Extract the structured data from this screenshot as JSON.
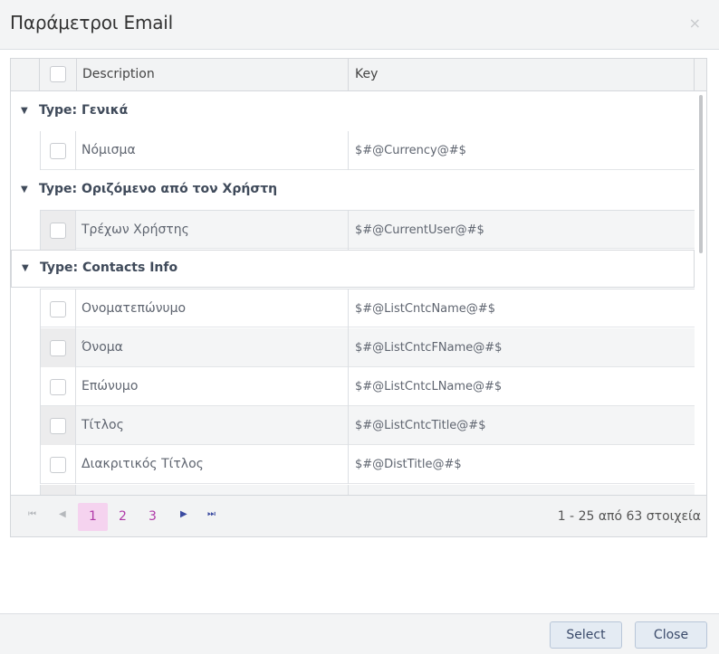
{
  "dialog": {
    "title": "Παράμετροι Email",
    "close_glyph": "×"
  },
  "grid": {
    "columns": {
      "description": "Description",
      "key": "Key"
    },
    "groups": [
      {
        "label": "Type: Γενικά",
        "rows": [
          {
            "description": "Νόμισμα",
            "key": "$#@Currency@#$"
          }
        ]
      },
      {
        "label": "Type: Οριζόμενο από τον Χρήστη",
        "rows": [
          {
            "description": "Τρέχων Χρήστης",
            "key": "$#@CurrentUser@#$"
          }
        ]
      },
      {
        "label": "Type: Contacts Info",
        "rows": [
          {
            "description": "Ονοματεπώνυμο",
            "key": "$#@ListCntcName@#$"
          },
          {
            "description": "Όνομα",
            "key": "$#@ListCntcFName@#$"
          },
          {
            "description": "Επώνυμο",
            "key": "$#@ListCntcLName@#$"
          },
          {
            "description": "Τίτλος",
            "key": "$#@ListCntcTitle@#$"
          },
          {
            "description": "Διακριτικός Τίτλος",
            "key": "$#@DistTitle@#$"
          }
        ]
      }
    ]
  },
  "pager": {
    "first_icon": "first-page-icon",
    "prev_icon": "prev-page-icon",
    "next_icon": "next-page-icon",
    "last_icon": "last-page-icon",
    "pages": [
      "1",
      "2",
      "3"
    ],
    "current_page": "1",
    "info": "1 - 25 από 63 στοιχεία"
  },
  "footer": {
    "select_label": "Select",
    "close_label": "Close"
  }
}
